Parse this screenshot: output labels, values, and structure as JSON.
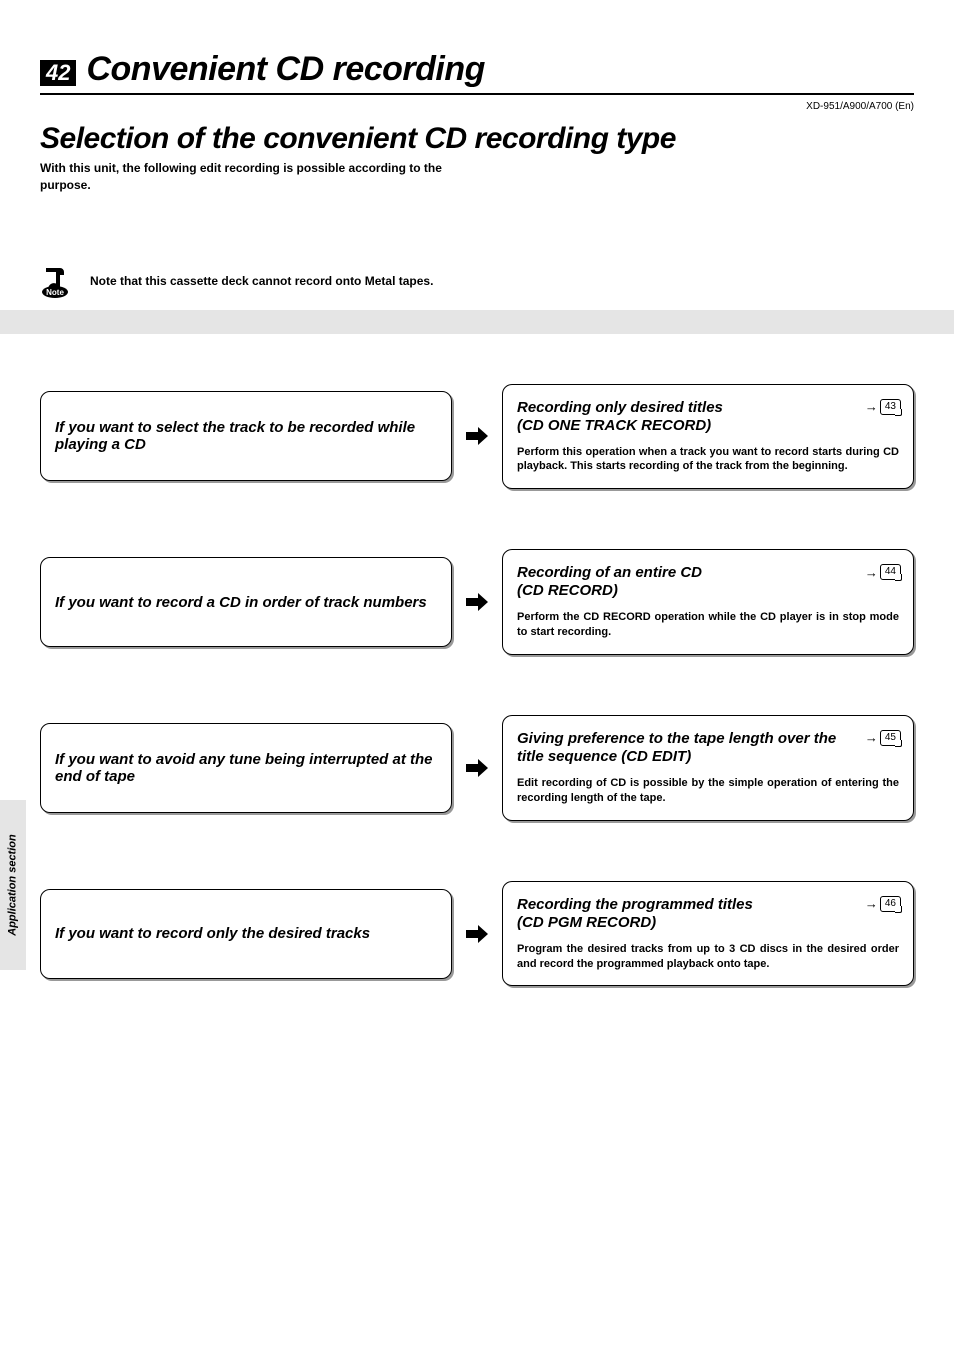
{
  "page_number": "42",
  "chapter_title": "Convenient CD recording",
  "model_line": "XD-951/A900/A700 (En)",
  "section_title": "Selection of the convenient CD recording type",
  "intro_text": "With this unit, the following edit recording is possible according to the purpose.",
  "note_label": "Note",
  "note_text": "Note that this cassette deck cannot record onto Metal tapes.",
  "side_tab": "Application section",
  "pairs": [
    {
      "left": "If you want to select the track to be recorded while playing a CD",
      "right_title": "Recording only desired titles\n(CD ONE TRACK RECORD)",
      "right_desc": "Perform this operation when a track you want to record starts during CD playback. This starts recording of the track from the beginning.",
      "page_ref": "43"
    },
    {
      "left": "If you want to record a CD in order of track numbers",
      "right_title": "Recording of an entire CD\n(CD RECORD)",
      "right_desc": "Perform the CD RECORD operation while the CD player is in stop mode to start recording.",
      "page_ref": "44"
    },
    {
      "left": "If you want to avoid any tune being interrupted at the end of tape",
      "right_title": "Giving preference to the tape length over the title sequence (CD EDIT)",
      "right_desc": "Edit recording of CD is possible by the simple operation of entering the recording length of the tape.",
      "page_ref": "45"
    },
    {
      "left": "If you want to record only the desired tracks",
      "right_title": "Recording the programmed titles\n(CD PGM RECORD)",
      "right_desc": "Program the desired tracks from up to 3 CD discs in the desired order and record the programmed playback onto tape.",
      "page_ref": "46"
    }
  ]
}
